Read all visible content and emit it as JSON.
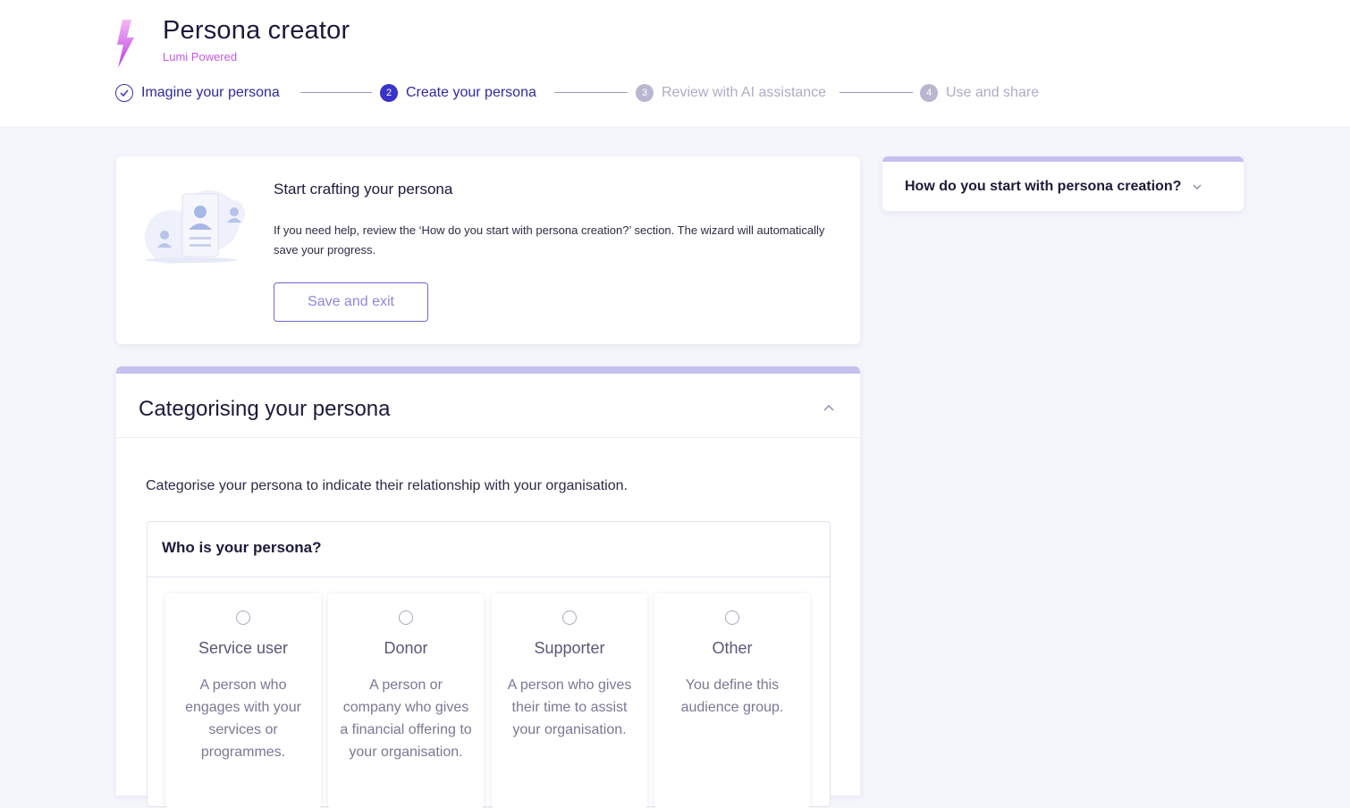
{
  "header": {
    "title": "Persona creator",
    "subtitle": "Lumi Powered"
  },
  "stepper": [
    {
      "number": "",
      "label": "Imagine your persona",
      "state": "done"
    },
    {
      "number": "2",
      "label": "Create your persona",
      "state": "active"
    },
    {
      "number": "3",
      "label": "Review with AI assistance",
      "state": "todo"
    },
    {
      "number": "4",
      "label": "Use and share",
      "state": "todo"
    }
  ],
  "intro": {
    "title": "Start crafting your persona",
    "text": "If you need help, review the ‘How do you start with persona creation?’ section. The wizard will automatically save your progress.",
    "button": "Save and exit"
  },
  "help": {
    "title": "How do you start with persona creation?"
  },
  "section": {
    "title": "Categorising your persona",
    "intro": "Categorise your persona to indicate their relationship with your organisation.",
    "question": "Who is your persona?",
    "options": [
      {
        "title": "Service user",
        "desc": "A person who engages with your services or programmes."
      },
      {
        "title": "Donor",
        "desc": "A person or company who gives a financial offering to your organisation."
      },
      {
        "title": "Supporter",
        "desc": "A person who gives their time to assist your organisation."
      },
      {
        "title": "Other",
        "desc": "You define this audience group."
      }
    ]
  },
  "colors": {
    "accent": "#3a33c9",
    "brand": "#c25be0",
    "section_bar": "#c3c1ed"
  }
}
